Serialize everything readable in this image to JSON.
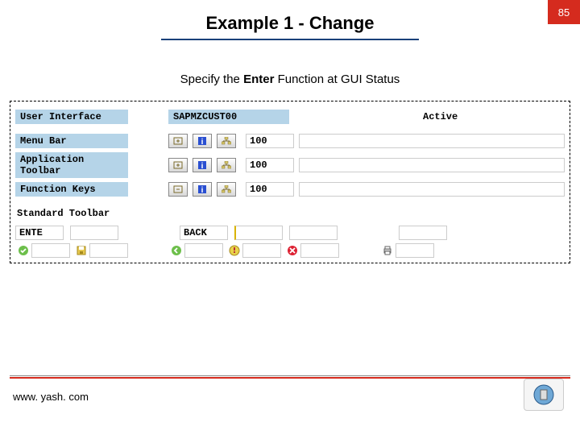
{
  "header": {
    "title": "Example 1 - Change",
    "page_number": "85"
  },
  "subtitle": {
    "prefix": "Specify the ",
    "bold": "Enter",
    "suffix": " Function at GUI Status"
  },
  "panel": {
    "user_interface_label": "User Interface",
    "program_name": "SAPMZCUST00",
    "status": "Active",
    "rows": [
      {
        "label": "Menu Bar",
        "value": "100"
      },
      {
        "label": "Application Toolbar",
        "value": "100"
      },
      {
        "label": "Function Keys",
        "value": "100"
      }
    ],
    "std_toolbar_label": "Standard Toolbar",
    "toolbar_codes": [
      "ENTE",
      "",
      "",
      "BACK",
      "",
      "",
      "",
      ""
    ]
  },
  "footer": {
    "url": "www. yash. com"
  }
}
